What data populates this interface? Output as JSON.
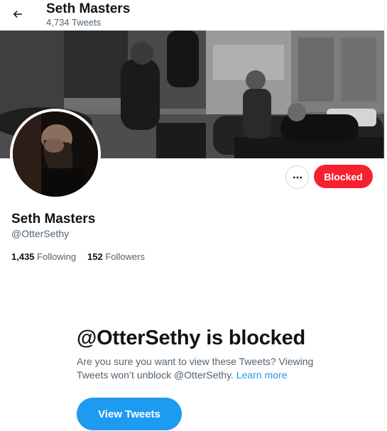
{
  "header": {
    "name": "Seth Masters",
    "tweet_count": "4,734 Tweets"
  },
  "profile": {
    "name": "Seth Masters",
    "handle": "@OtterSethy",
    "following_count": "1,435",
    "following_label": "Following",
    "followers_count": "152",
    "followers_label": "Followers"
  },
  "actions": {
    "more_label": "•••",
    "blocked_label": "Blocked"
  },
  "blocked_notice": {
    "title": "@OtterSethy is blocked",
    "description": "Are you sure you want to view these Tweets? Viewing Tweets won’t unblock @OtterSethy.",
    "learn_more": "Learn more",
    "view_button": "View Tweets"
  },
  "colors": {
    "accent": "#1d9bf0",
    "blocked": "#f4212e",
    "secondary_text": "#536471"
  },
  "icons": {
    "back": "arrow-left-icon",
    "more": "more-horizontal-icon"
  }
}
